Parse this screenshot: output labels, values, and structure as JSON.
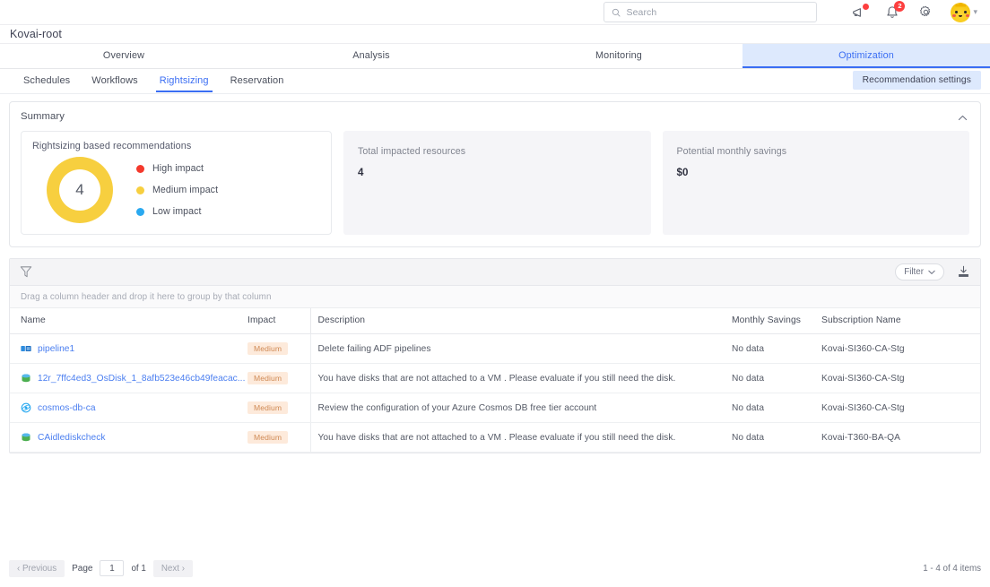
{
  "topbar": {
    "search_placeholder": "Search",
    "search_value": "",
    "icons": {
      "megaphone": "megaphone-icon",
      "bell": "bell-icon",
      "gear": "gear-icon",
      "avatar": "avatar-pikachu"
    },
    "notification_count": "2"
  },
  "org": {
    "name": "Kovai-root"
  },
  "main_tabs": [
    {
      "label": "Overview",
      "active": false
    },
    {
      "label": "Analysis",
      "active": false
    },
    {
      "label": "Monitoring",
      "active": false
    },
    {
      "label": "Optimization",
      "active": true
    }
  ],
  "sub_tabs": [
    {
      "label": "Schedules",
      "active": false
    },
    {
      "label": "Workflows",
      "active": false
    },
    {
      "label": "Rightsizing",
      "active": true
    },
    {
      "label": "Reservation",
      "active": false
    }
  ],
  "recommendation_settings_label": "Recommendation settings",
  "summary": {
    "title": "Summary",
    "collapse_icon": "chevron-up-icon",
    "donut_card_title": "Rightsizing based recommendations",
    "legend": [
      {
        "label": "High impact",
        "color": "#f4392c"
      },
      {
        "label": "Medium impact",
        "color": "#f7cf3f"
      },
      {
        "label": "Low impact",
        "color": "#2aa9f0"
      }
    ],
    "stats": [
      {
        "label": "Total impacted resources",
        "value": "4"
      },
      {
        "label": "Potential monthly savings",
        "value": "$0"
      }
    ]
  },
  "chart_data": {
    "type": "pie",
    "title": "Rightsizing based recommendations",
    "center_label": "4",
    "categories": [
      "High impact",
      "Medium impact",
      "Low impact"
    ],
    "values": [
      0,
      4,
      0
    ],
    "colors": [
      "#f4392c",
      "#f7cf3f",
      "#2aa9f0"
    ],
    "legend_position": "right",
    "total": 4
  },
  "grid_toolbar": {
    "filter_icon": "funnel-icon",
    "filter_label": "Filter",
    "filter_caret": "chevron-down-icon",
    "export_icon": "export-icon"
  },
  "group_hint": "Drag a column header and drop it here to group by that column",
  "table": {
    "columns": [
      "Name",
      "Impact",
      "Description",
      "Monthly Savings",
      "Subscription Name"
    ],
    "rows": [
      {
        "icon": "azure-data-factory-icon",
        "name": "pipeline1",
        "impact": "Medium",
        "description": "Delete failing ADF pipelines",
        "savings": "No data",
        "subscription": "Kovai-SI360-CA-Stg"
      },
      {
        "icon": "azure-disk-icon",
        "name": "12r_7ffc4ed3_OsDisk_1_8afb523e46cb49feacac...",
        "impact": "Medium",
        "description": "You have disks that are not attached to a VM . Please evaluate if you still need the disk.",
        "savings": "No data",
        "subscription": "Kovai-SI360-CA-Stg"
      },
      {
        "icon": "azure-cosmos-db-icon",
        "name": "cosmos-db-ca",
        "impact": "Medium",
        "description": "Review the configuration of your Azure Cosmos DB free tier account",
        "savings": "No data",
        "subscription": "Kovai-SI360-CA-Stg"
      },
      {
        "icon": "azure-disk-icon",
        "name": "CAidlediskcheck",
        "impact": "Medium",
        "description": "You have disks that are not attached to a VM . Please evaluate if you still need the disk.",
        "savings": "No data",
        "subscription": "Kovai-T360-BA-QA"
      }
    ]
  },
  "pagination": {
    "previous_label": "Previous",
    "page_label": "Page",
    "page_value": "1",
    "of_label": "of 1",
    "next_label": "Next",
    "range_text": "1 - 4 of 4 items"
  }
}
